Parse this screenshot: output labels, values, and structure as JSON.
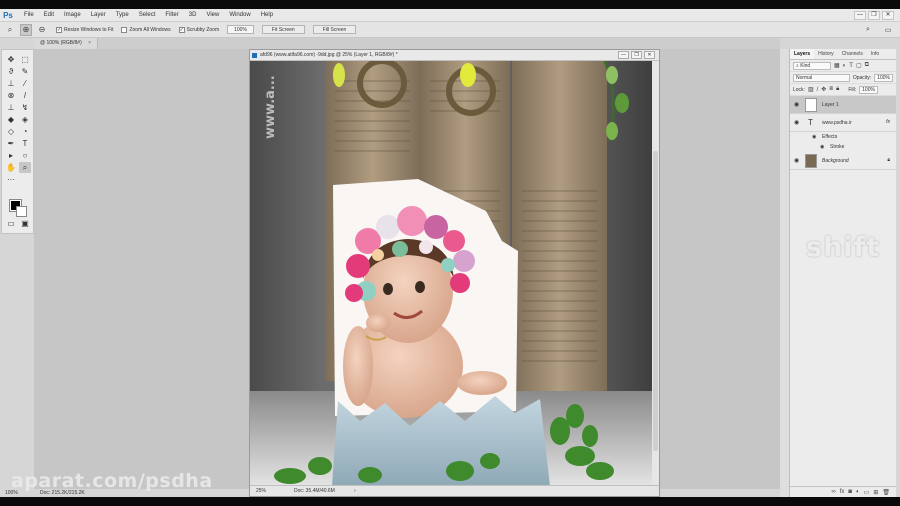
{
  "app": {
    "logo": "Ps",
    "menus": [
      "File",
      "Edit",
      "Image",
      "Layer",
      "Type",
      "Select",
      "Filter",
      "3D",
      "View",
      "Window",
      "Help"
    ],
    "window_controls": [
      "—",
      "❐",
      "✕"
    ]
  },
  "options_bar": {
    "resize_windows_label": "Resize Windows to Fit",
    "zoom_all_label": "Zoom All Windows",
    "scrubby_zoom_label": "Scrubby Zoom",
    "zoom_value": "100%",
    "fit_screen_label": "Fit Screen",
    "fill_screen_label": "Fill Screen"
  },
  "doc_tab": {
    "label": "@ 100% (RGB/8#)",
    "close": "×"
  },
  "document": {
    "title": "afd96 (www.atifa96.com) -9dd.jpg @ 25% (Layer 1, RGB/8#) *",
    "zoom": "25%",
    "doc_size": "Doc: 35.4M/40.6M",
    "photo_watermark": "www.a..."
  },
  "status_bar": {
    "zoom": "100%",
    "doc_size": "Doc: 215.2K/215.2K"
  },
  "layers_panel": {
    "tabs": [
      "Layers",
      "History",
      "Channels",
      "Info"
    ],
    "kind_label": "Kind",
    "blend_mode": "Normal",
    "opacity_label": "Opacity:",
    "opacity_value": "100%",
    "lock_label": "Lock:",
    "fill_label": "Fill:",
    "fill_value": "100%",
    "layers": [
      {
        "name": "Layer 1"
      },
      {
        "name": "www.psdha.ir",
        "fx": "fx"
      },
      {
        "name": "Background"
      }
    ],
    "effects_label": "Effects",
    "stroke_label": "Stroke"
  },
  "overlays": {
    "key_hint": "shift",
    "watermark": "aparat.com/psdha"
  },
  "colors": {
    "foreground": "#000000",
    "background": "#ffffff",
    "ps_blue": "#1f6fb5"
  }
}
